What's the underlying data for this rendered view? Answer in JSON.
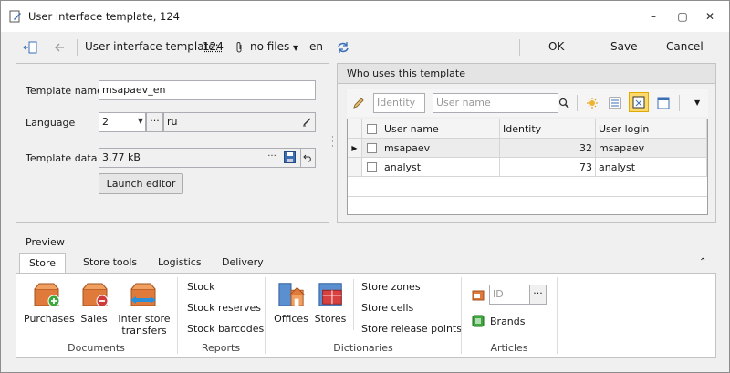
{
  "window": {
    "title": "User interface template, 124",
    "controls": {
      "minimize": "–",
      "maximize": "▢",
      "close": "✕"
    }
  },
  "toolbar": {
    "template_label": "User interface template:",
    "template_id": "124",
    "files_label": "no files",
    "lang": "en",
    "ok": "OK",
    "save": "Save",
    "cancel": "Cancel"
  },
  "form": {
    "template_name_label": "Template name",
    "template_name_value": "msapaev_en",
    "language_label": "Language",
    "language_id": "2",
    "language_name": "ru",
    "template_data_label": "Template data",
    "template_data_value": "3.77 kB",
    "launch_editor": "Launch editor"
  },
  "who_uses": {
    "header": "Who uses this template",
    "identity_placeholder": "Identity",
    "username_placeholder": "User name",
    "columns": [
      "User name",
      "Identity",
      "User login"
    ],
    "rows": [
      {
        "user_name": "msapaev",
        "identity": "32",
        "login": "msapaev"
      },
      {
        "user_name": "analyst",
        "identity": "73",
        "login": "analyst"
      }
    ]
  },
  "preview": {
    "label": "Preview",
    "tabs": [
      "Store",
      "Store tools",
      "Logistics",
      "Delivery"
    ],
    "active_tab": "Store",
    "groups": {
      "documents": {
        "label": "Documents",
        "items": [
          "Purchases",
          "Sales",
          "Inter store transfers"
        ]
      },
      "reports": {
        "label": "Reports",
        "items": [
          "Stock",
          "Stock reserves",
          "Stock barcodes"
        ]
      },
      "dictionaries": {
        "label": "Dictionaries",
        "big_items": [
          "Offices",
          "Stores"
        ],
        "items": [
          "Store zones",
          "Store cells",
          "Store release points"
        ]
      },
      "articles": {
        "label": "Articles",
        "id_placeholder": "ID",
        "brands": "Brands"
      }
    },
    "transfers_line1": "Inter store",
    "transfers_line2": "transfers"
  }
}
